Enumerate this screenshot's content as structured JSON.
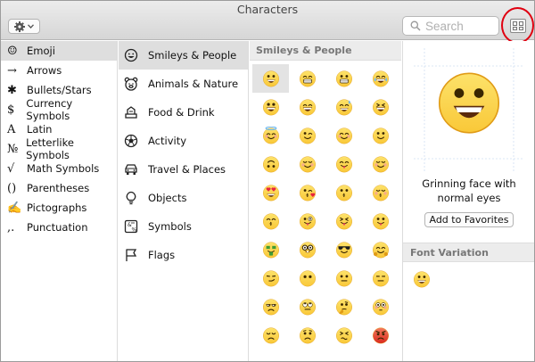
{
  "window": {
    "title": "Characters"
  },
  "toolbar": {
    "search_placeholder": "Search"
  },
  "primary_categories": [
    {
      "icon": "☺",
      "label": "Emoji",
      "selected": true
    },
    {
      "icon": "→",
      "label": "Arrows"
    },
    {
      "icon": "✱",
      "label": "Bullets/Stars"
    },
    {
      "icon": "$",
      "label": "Currency Symbols"
    },
    {
      "icon": "A",
      "label": "Latin"
    },
    {
      "icon": "№",
      "label": "Letterlike Symbols"
    },
    {
      "icon": "√",
      "label": "Math Symbols"
    },
    {
      "icon": "()",
      "label": "Parentheses"
    },
    {
      "icon": "✍",
      "label": "Pictographs"
    },
    {
      "icon": ",.",
      "label": "Punctuation"
    }
  ],
  "emoji_categories": [
    {
      "icon": "smiley-icon",
      "label": "Smileys & People",
      "selected": true
    },
    {
      "icon": "bear-icon",
      "label": "Animals & Nature"
    },
    {
      "icon": "food-icon",
      "label": "Food & Drink"
    },
    {
      "icon": "ball-icon",
      "label": "Activity"
    },
    {
      "icon": "car-icon",
      "label": "Travel & Places"
    },
    {
      "icon": "lightbulb-icon",
      "label": "Objects"
    },
    {
      "icon": "symbols-icon",
      "label": "Symbols"
    },
    {
      "icon": "flag-icon",
      "label": "Flags"
    }
  ],
  "grid": {
    "section_title": "Smileys & People",
    "emojis": [
      "grinning",
      "grin",
      "grimace",
      "tears-of-joy",
      "smile-open",
      "smile-big",
      "sweat-smile",
      "laughing",
      "halo",
      "wink",
      "blush",
      "slight-smile",
      "upside-down",
      "relieved",
      "yum",
      "relaxed",
      "heart-eyes",
      "kiss-heart",
      "kiss",
      "kiss-closed",
      "kiss-smile",
      "tongue-wink",
      "tongue-closed",
      "tongue",
      "money",
      "nerd",
      "sunglasses",
      "hug",
      "smirk",
      "no-mouth",
      "neutral",
      "expressionless",
      "unamused",
      "eye-roll",
      "thinking",
      "flushed",
      "disappointed",
      "worried",
      "persevere",
      "angry"
    ],
    "selected_index": 0
  },
  "detail": {
    "character_name": "Grinning face with normal eyes",
    "favorites_button": "Add to Favorites",
    "font_variation_title": "Font Variation"
  },
  "colors": {
    "face": "#f9c838",
    "face_dark": "#e09b16",
    "selection": "#dedede",
    "annotation": "#e00010"
  }
}
